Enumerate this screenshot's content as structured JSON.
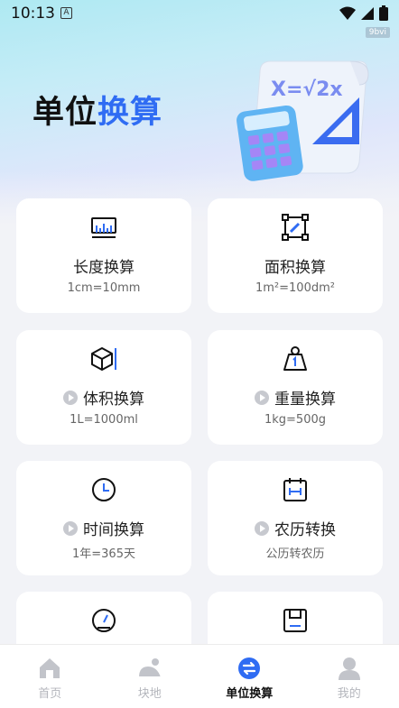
{
  "status_bar": {
    "time": "10:13",
    "notification_glyph": "A",
    "tag": "9bvi"
  },
  "header": {
    "title_part1": "单位",
    "title_part2": "换算",
    "hero_formula": "X=√2x"
  },
  "colors": {
    "accent": "#2f6cf3",
    "text": "#111111",
    "muted": "#b4b6bc",
    "background": "#f2f3f7"
  },
  "cards": [
    {
      "icon": "ruler-icon",
      "name": "长度换算",
      "example": "1cm=10mm",
      "premium": false
    },
    {
      "icon": "area-icon",
      "name": "面积换算",
      "example": "1m²=100dm²",
      "premium": false
    },
    {
      "icon": "cube-icon",
      "name": "体积换算",
      "example": "1L=1000ml",
      "premium": true
    },
    {
      "icon": "weight-icon",
      "name": "重量换算",
      "example": "1kg=500g",
      "premium": true
    },
    {
      "icon": "clock-icon",
      "name": "时间换算",
      "example": "1年=365天",
      "premium": true
    },
    {
      "icon": "calendar-icon",
      "name": "农历转换",
      "example": "公历转农历",
      "premium": true
    },
    {
      "icon": "speedometer-icon",
      "name": "",
      "example": "",
      "premium": false
    },
    {
      "icon": "storage-icon",
      "name": "",
      "example": "",
      "premium": false
    }
  ],
  "tabbar": {
    "items": [
      {
        "icon": "home-icon",
        "label": "首页",
        "active": false
      },
      {
        "icon": "land-icon",
        "label": "块地",
        "active": false
      },
      {
        "icon": "convert-icon",
        "label": "单位换算",
        "active": true
      },
      {
        "icon": "profile-icon",
        "label": "我的",
        "active": false
      }
    ]
  }
}
